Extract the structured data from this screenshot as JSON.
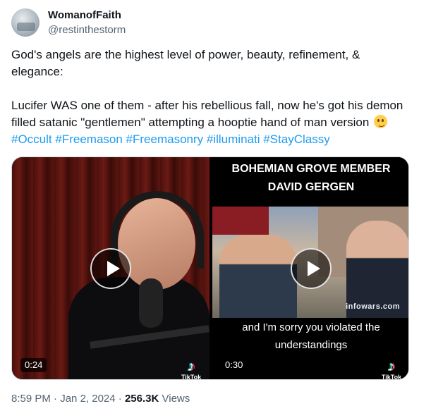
{
  "author": {
    "display_name": "WomanofFaith",
    "handle": "@restinthestorm"
  },
  "tweet": {
    "paragraph1": "God's angels are the highest level of power, beauty, refinement, & elegance:",
    "paragraph2_text": "Lucifer WAS one of them - after his rebellious fall, now he's got his demon filled satanic \"gentlemen\" attempting a hooptie hand of man version",
    "emoji": "woozy-face-emoji",
    "hashtags": [
      "#Occult",
      "#Freemason",
      "#Freemasonry",
      "#illuminati",
      "#StayClassy"
    ]
  },
  "media": {
    "left": {
      "duration": "0:24",
      "tiktok_label": "TikTok",
      "tiktok_glyph": "♪"
    },
    "right": {
      "title_line1": "BOHEMIAN GROVE MEMBER",
      "title_line2": "DAVID GERGEN",
      "watermark": "infowars.com",
      "caption_line1": "and I'm sorry you violated the",
      "caption_line2": "understandings",
      "duration": "0:30",
      "tiktok_label": "TikTok",
      "tiktok_glyph": "♪"
    }
  },
  "meta": {
    "time": "8:59 PM",
    "separator": "·",
    "date": "Jan 2, 2024",
    "views_count": "256.3K",
    "views_label": "Views"
  },
  "colors": {
    "link": "#1d9bf0",
    "secondary_text": "#536471",
    "primary_text": "#0f1419"
  }
}
